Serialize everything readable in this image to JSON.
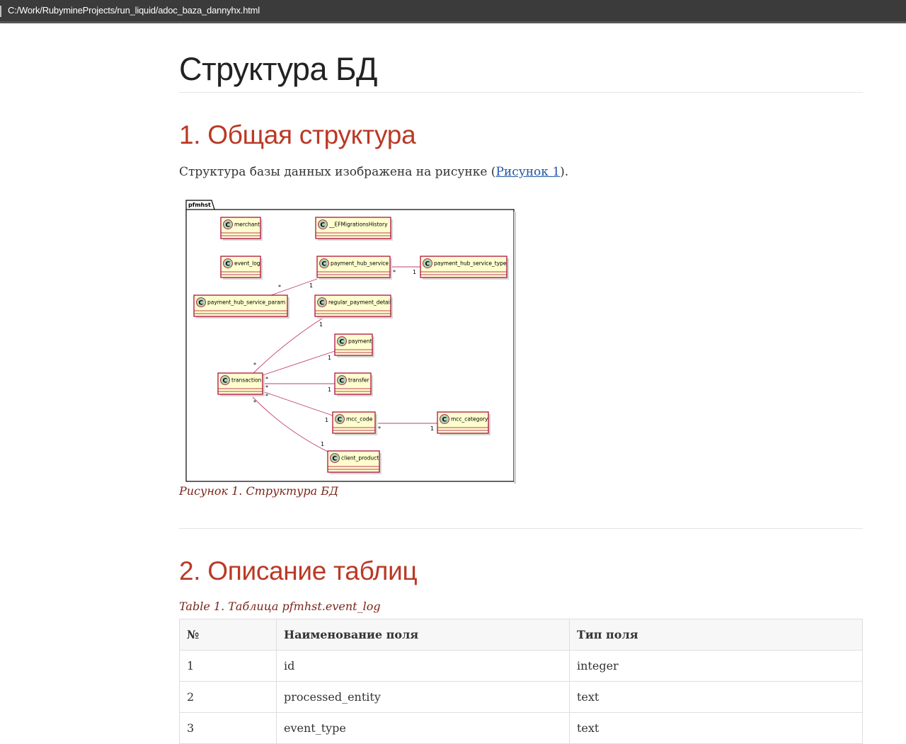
{
  "window": {
    "path": "C:/Work/RubymineProjects/run_liquid/adoc_baza_dannyhx.html"
  },
  "doc": {
    "title": "Структура БД"
  },
  "section1": {
    "heading": "1. Общая структура",
    "lead_text": "Структура базы данных изображена на рисунке (",
    "lead_link": "Рисунок 1",
    "lead_end": ").",
    "figure_caption": "Рисунок 1. Структура БД"
  },
  "diagram": {
    "package": "pfmhst",
    "classes": {
      "merchant": "merchant",
      "ef_history": "__EFMigrationsHistory",
      "event_log": "event_log",
      "payment_hub_service": "payment_hub_service",
      "payment_hub_service_type": "payment_hub_service_type",
      "payment_hub_service_param": "payment_hub_service_param",
      "regular_payment_detail": "regular_payment_detail",
      "payment": "payment",
      "transaction": "transaction",
      "transfer": "transfer",
      "mcc_code": "mcc_code",
      "mcc_category": "mcc_category",
      "client_product": "client_product"
    },
    "class_marker": "C",
    "mult_many": "*",
    "mult_one": "1"
  },
  "section2": {
    "heading": "2. Описание таблиц",
    "table_caption": "Table 1. Таблица pfmhst.event_log",
    "columns": [
      "№",
      "Наименование поля",
      "Тип поля"
    ],
    "rows": [
      [
        "1",
        "id",
        "integer"
      ],
      [
        "2",
        "processed_entity",
        "text"
      ],
      [
        "3",
        "event_type",
        "text"
      ]
    ]
  }
}
